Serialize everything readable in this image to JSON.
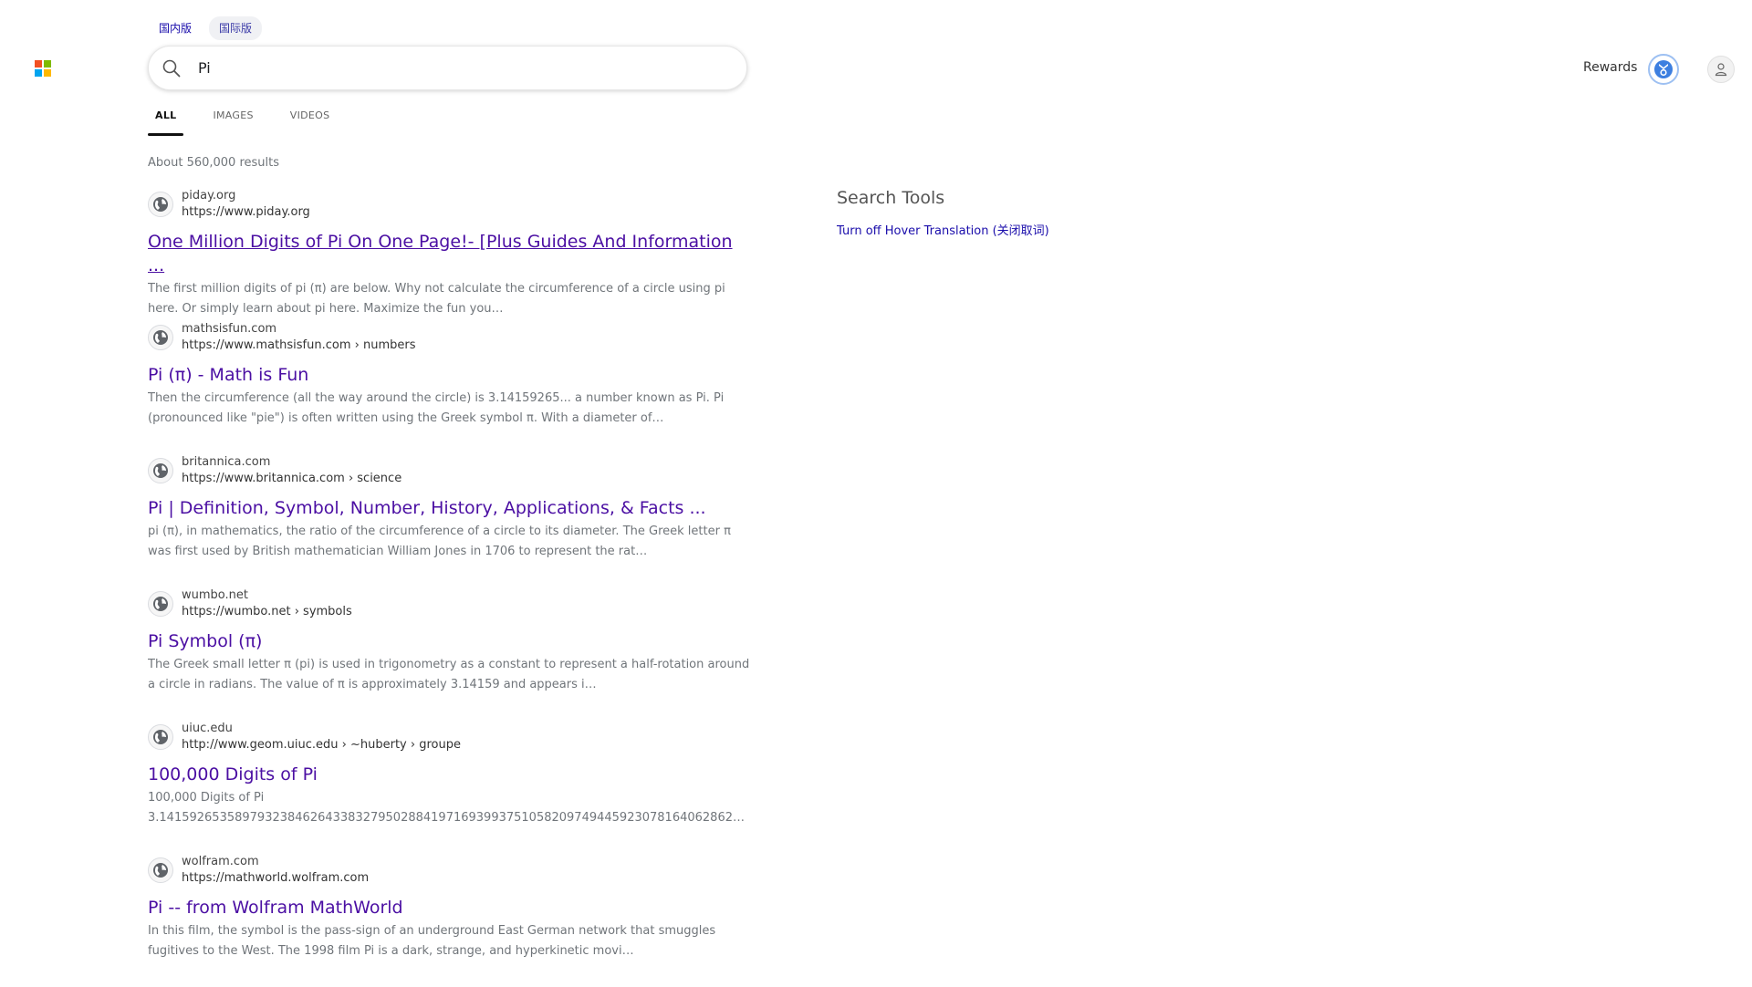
{
  "region_tabs": [
    {
      "label": "国内版",
      "active": false
    },
    {
      "label": "国际版",
      "active": true
    }
  ],
  "logo": {
    "colors": [
      "#f25022",
      "#7fba00",
      "#00a4ef",
      "#ffb900"
    ]
  },
  "search": {
    "value": "Pi",
    "icon": "search-icon"
  },
  "header": {
    "rewards_label": "Rewards",
    "rewards_icon": "rewards-medal-icon",
    "profile_icon": "user-icon"
  },
  "scope_tabs": [
    {
      "label": "ALL",
      "active": true
    },
    {
      "label": "IMAGES",
      "active": false
    },
    {
      "label": "VIDEOS",
      "active": false
    }
  ],
  "results_count": "About 560,000 results",
  "results": [
    {
      "site": "piday.org",
      "url": "https://www.piday.org",
      "title": "One Million Digits of Pi On One Page!- [Plus Guides And Information ...",
      "snippet": "The first million digits of pi (π) are below. Why not calculate the circumference of a circle using pi here. Or simply learn about pi here. Maximize the fun you…",
      "visited": true
    },
    {
      "site": "mathsisfun.com",
      "url": "https://www.mathsisfun.com › numbers",
      "title": "Pi (π) - Math is Fun",
      "snippet": "Then the circumference (all the way around the circle) is 3.14159265... a number known as Pi. Pi (pronounced like \"pie\") is often written using the Greek symbol π. With a diameter of…",
      "visited": false
    },
    {
      "site": "britannica.com",
      "url": "https://www.britannica.com › science",
      "title": "Pi | Definition, Symbol, Number, History, Applications, & Facts ...",
      "snippet": "pi (π), in mathematics, the ratio of the circumference of a circle to its diameter. The Greek letter π was first used by British mathematician William Jones in 1706 to represent the rat…",
      "visited": false
    },
    {
      "site": "wumbo.net",
      "url": "https://wumbo.net › symbols",
      "title": "Pi Symbol (π)",
      "snippet": "The Greek small letter π (pi) is used in trigonometry as a constant to represent a half-rotation around a circle in radians. The value of π is approximately 3.14159 and appears i…",
      "visited": false
    },
    {
      "site": "uiuc.edu",
      "url": "http://www.geom.uiuc.edu › ~huberty › groupe",
      "title": "100,000 Digits of Pi",
      "snippet": "100,000 Digits of Pi 3.1415926535897932384626433832795028841971693993751058209749445923078164062862…",
      "visited": false
    },
    {
      "site": "wolfram.com",
      "url": "https://mathworld.wolfram.com",
      "title": "Pi -- from Wolfram MathWorld",
      "snippet": "In this film, the symbol is the pass-sign of an underground East German network that smuggles fugitives to the West. The 1998 film Pi is a dark, strange, and hyperkinetic movi…",
      "visited": false
    }
  ],
  "search_tools": {
    "heading": "Search Tools",
    "hover_link": "Turn off Hover Translation (关闭取词)"
  }
}
